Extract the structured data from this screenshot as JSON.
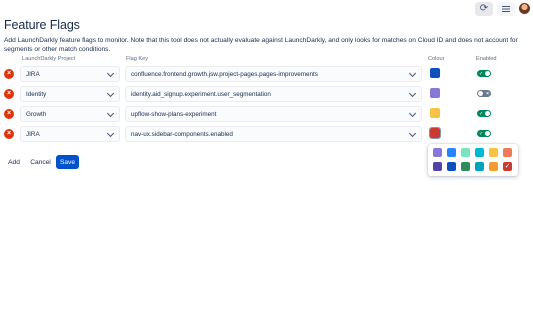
{
  "toolbar": {
    "refresh_icon": "refresh-icon",
    "menu_icon": "hamburger-menu-icon",
    "avatar": "user-avatar"
  },
  "page": {
    "title": "Feature Flags",
    "description": "Add LaunchDarkly feature flags to monitor. Note that this tool does not actually evaluate against LaunchDarkly, and only looks for matches on Cloud ID and does not account for segments or other match conditions."
  },
  "columns": {
    "project": "LaunchDarkly Project",
    "flag_key": "Flag Key",
    "colour": "Colour",
    "enabled": "Enabled"
  },
  "flags": [
    {
      "project": "JIRA",
      "flag_key": "confluence.frontend.growth.jsw.project-pages.pages-improvements",
      "colour": "#0c4fbd",
      "enabled": true
    },
    {
      "project": "Identity",
      "flag_key": "identity.aid_signup.experiment.user_segmentation",
      "colour": "#8777d9",
      "enabled": false
    },
    {
      "project": "Growth",
      "flag_key": "upflow-show-plans-experiment",
      "colour": "#f6c343",
      "enabled": true
    },
    {
      "project": "JIRA",
      "flag_key": "nav-ux.sidebar-components.enabled",
      "colour": "#ca3a2e",
      "enabled": true
    }
  ],
  "buttons": {
    "add": "Add",
    "cancel": "Cancel",
    "save": "Save"
  },
  "palette": {
    "row1": [
      "#8777d9",
      "#2684ff",
      "#79e2bf",
      "#00b8d9",
      "#f6c343",
      "#ef7b5b"
    ],
    "row2": [
      "#5243aa",
      "#0c4fbd",
      "#2f8a5c",
      "#00a3bf",
      "#f29b2e",
      "#ca3a2e"
    ],
    "selected": "#ca3a2e",
    "check_glyph": "✓"
  }
}
